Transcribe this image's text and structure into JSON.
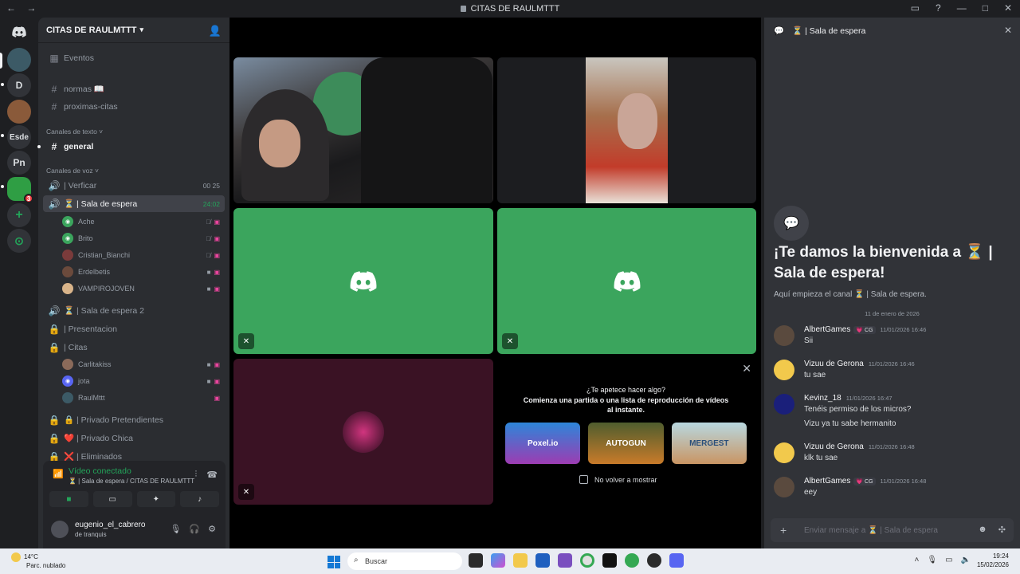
{
  "window": {
    "title": "CITAS DE RAULMTTT",
    "back": "←",
    "forward": "→",
    "controls": [
      "▭",
      "?",
      "—",
      "□",
      "✕"
    ]
  },
  "rail": {
    "items": [
      "D",
      "Esde",
      "Pn"
    ],
    "badge": "3",
    "add": "+",
    "explore": "⊙"
  },
  "sidebar": {
    "server_name": "CITAS DE RAULMTTT",
    "events": "Eventos",
    "channels_top": [
      "normas 📖",
      "proximas-citas"
    ],
    "text_category": "Canales de texto",
    "general": "general",
    "voice_category": "Canales de voz",
    "verificar": {
      "name": "| Verficar",
      "tag1": "00",
      "tag2": "25"
    },
    "sala": {
      "name": "⏳ | Sala de espera",
      "time": "24:02"
    },
    "sala_users": [
      "Ache",
      "Brito",
      "Cristian_Bianchi",
      "Erdelbetis",
      "VAMPIROJOVEN"
    ],
    "more_channels": [
      "⏳ | Sala de espera 2",
      "| Presentacion",
      "| Citas"
    ],
    "citas_users": [
      "Carlitakiss",
      "jota",
      "RaulMttt"
    ],
    "bottom_channels": [
      "🔒 | Privado Pretendientes",
      "❤️ | Privado Chica",
      "❌ | Eliminados"
    ]
  },
  "voice": {
    "status": "Vídeo conectado",
    "location": "⏳ | Sala de espera / CITAS DE RAULMTTT"
  },
  "user": {
    "name": "eugenio_el_cabrero",
    "status": "de tranquis"
  },
  "activity": {
    "question": "¿Te apetece hacer algo?",
    "prompt": "Comienza una partida o una lista de reproducción de vídeos al instante.",
    "games": [
      "Poxel.io",
      "AUTOGUN",
      "MERGEST"
    ],
    "dont_show": "No volver a mostrar",
    "close": "✕"
  },
  "chat": {
    "header": "⏳ | Sala de espera",
    "welcome": "¡Te damos la bienvenida a ⏳ | Sala de espera!",
    "welcome_sub": "Aquí empieza el canal ⏳ | Sala de espera.",
    "date": "11 de enero de 2026",
    "messages": [
      {
        "author": "AlbertGames",
        "tag": "💗 CG",
        "time": "11/01/2026 16:46",
        "text": "Sii"
      },
      {
        "author": "Vizuu de Gerona",
        "tag": "",
        "time": "11/01/2026 16:46",
        "text": "tu sae"
      },
      {
        "author": "Kevinz_18",
        "tag": "",
        "time": "11/01/2026 16:47",
        "text": "Tenéis permiso de los micros?",
        "text2": "Vizu ya tu sabe hermanito"
      },
      {
        "author": "Vizuu de Gerona",
        "tag": "",
        "time": "11/01/2026 16:48",
        "text": "klk tu sae"
      },
      {
        "author": "AlbertGames",
        "tag": "💗 CG",
        "time": "11/01/2026 16:48",
        "text": "eey"
      }
    ],
    "input_placeholder": "Enviar mensaje a ⏳ | Sala de espera"
  },
  "taskbar": {
    "temp": "14°C",
    "weather": "Parc. nublado",
    "search": "Buscar",
    "time": "19:24",
    "date": "15/02/2026"
  },
  "colors": {
    "accent": "#5865f2",
    "green": "#3ba55d",
    "online": "#23a55a"
  }
}
